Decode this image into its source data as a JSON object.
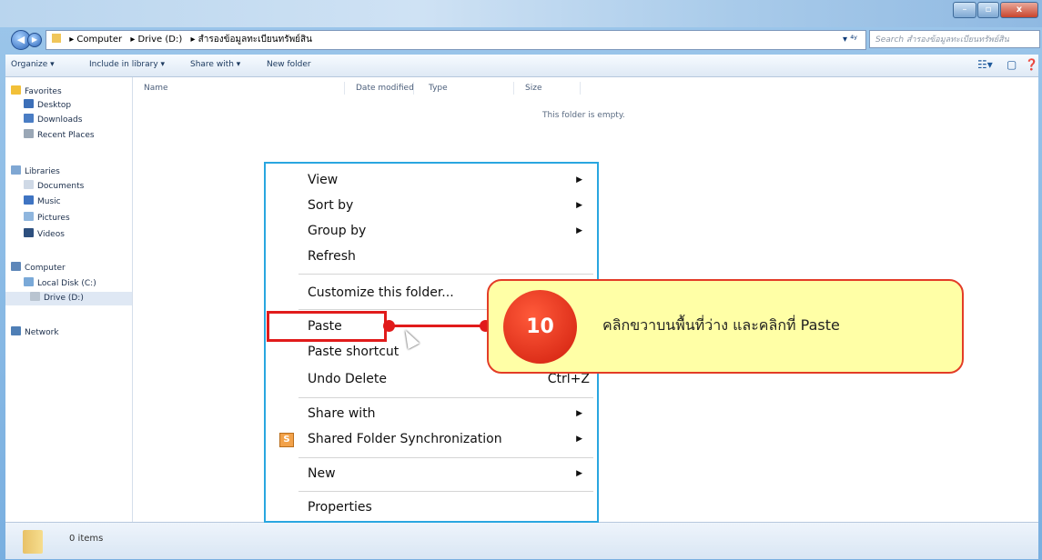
{
  "window": {
    "title": "",
    "controls": {
      "minimize": "–",
      "maximize": "▫",
      "close": "x"
    }
  },
  "address_bar": {
    "breadcrumbs": [
      "Computer",
      "Drive (D:)",
      "สำรองข้อมูลทะเบียนทรัพย์สิน"
    ],
    "search_placeholder": "Search สำรองข้อมูลทะเบียนทรัพย์สิน"
  },
  "toolbar": {
    "items": [
      "Organize ▾",
      "Include in library ▾",
      "Share with ▾",
      "New folder"
    ]
  },
  "nav": {
    "favorites": "Favorites",
    "desktop": "Desktop",
    "downloads": "Downloads",
    "recent": "Recent Places",
    "libraries": "Libraries",
    "documents": "Documents",
    "music": "Music",
    "pictures": "Pictures",
    "videos": "Videos",
    "computer": "Computer",
    "local_disk": "Local Disk (C:)",
    "drive_d": "Drive (D:)",
    "network": "Network"
  },
  "content": {
    "columns": [
      "Name",
      "Date modified",
      "Type",
      "Size"
    ],
    "empty_message": "This folder is empty."
  },
  "status": {
    "items_count": "0 items"
  },
  "context_menu": {
    "view": "View",
    "sort_by": "Sort by",
    "group_by": "Group by",
    "refresh": "Refresh",
    "customize": "Customize this folder...",
    "paste": "Paste",
    "paste_shortcut": "Paste shortcut",
    "undo_delete": "Undo Delete",
    "undo_shortcut": "Ctrl+Z",
    "share_with": "Share with",
    "shared_sync": "Shared Folder Synchronization",
    "new": "New",
    "properties": "Properties"
  },
  "annotation": {
    "step_number": "10",
    "instruction": "คลิกขวาบนพื้นที่ว่าง และคลิกที่   Paste"
  },
  "colors": {
    "highlight_red": "#e11b1b",
    "callout_bg": "#ffffa6",
    "menu_border": "#29a6e0"
  }
}
